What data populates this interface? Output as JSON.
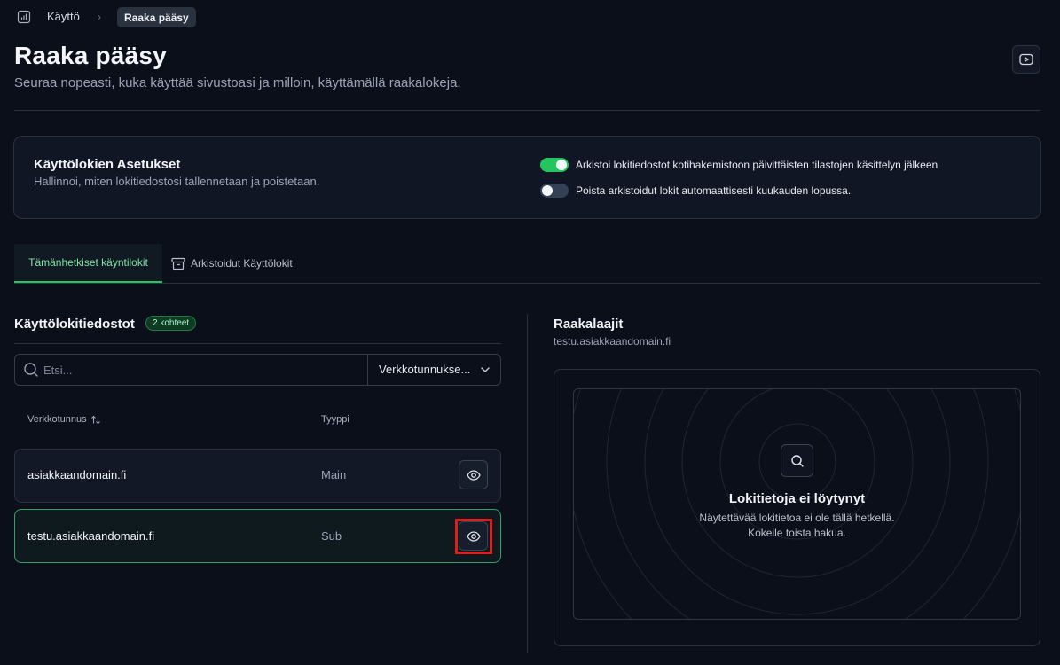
{
  "breadcrumb": {
    "parent": "Käyttö",
    "current": "Raaka pääsy"
  },
  "icons": {
    "breadcrumb": "chart-icon",
    "video": "video-icon",
    "archive": "archive-icon",
    "search": "search-icon",
    "chevron": "chevron-down-icon",
    "eye": "eye-icon",
    "sort": "sort-icon"
  },
  "page": {
    "title": "Raaka pääsy",
    "subtitle": "Seuraa nopeasti, kuka käyttää sivustoasi ja milloin, käyttämällä raakalokeja."
  },
  "settings": {
    "title": "Käyttölokien Asetukset",
    "subtitle": "Hallinnoi, miten lokitiedostosi tallennetaan ja poistetaan.",
    "toggles": [
      {
        "label": "Arkistoi lokitiedostot kotihakemistoon päivittäisten tilastojen käsittelyn jälkeen",
        "on": true
      },
      {
        "label": "Poista arkistoidut lokit automaattisesti kuukauden lopussa.",
        "on": false
      }
    ]
  },
  "tabs": [
    {
      "label": "Tämänhetkiset käyntilokit",
      "active": true
    },
    {
      "label": "Arkistoidut Käyttölokit",
      "active": false
    }
  ],
  "files": {
    "title": "Käyttölokitiedostot",
    "badge": "2 kohteet",
    "search_placeholder": "Etsi...",
    "filter_label": "Verkkotunnukse...",
    "columns": {
      "domain": "Verkkotunnus",
      "type": "Tyyppi"
    },
    "rows": [
      {
        "domain": "asiakkaandomain.fi",
        "type": "Main",
        "selected": false
      },
      {
        "domain": "testu.asiakkaandomain.fi",
        "type": "Sub",
        "selected": true
      }
    ]
  },
  "raw": {
    "title": "Raakalaajit",
    "domain": "testu.asiakkaandomain.fi",
    "empty_title": "Lokitietoja ei löytynyt",
    "empty_line1": "Näytettävää lokitietoa ei ole tällä hetkellä.",
    "empty_line2": "Kokeile toista hakua."
  },
  "colors": {
    "accent": "#22c55e",
    "background": "#0b0f1a",
    "card": "#111624",
    "highlight": "#e11d1d"
  }
}
